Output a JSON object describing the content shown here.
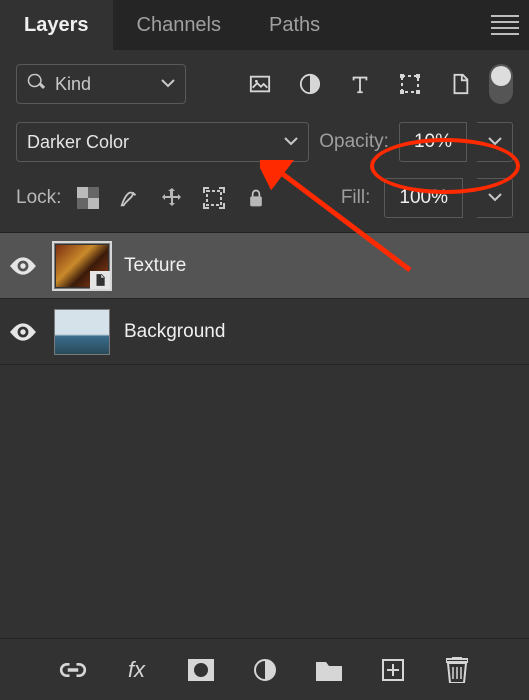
{
  "tabs": {
    "layers": "Layers",
    "channels": "Channels",
    "paths": "Paths"
  },
  "filter": {
    "kind_label": "Kind"
  },
  "blend": {
    "mode": "Darker Color",
    "opacity_label": "Opacity:",
    "opacity_value": "10%"
  },
  "lock": {
    "label": "Lock:",
    "fill_label": "Fill:",
    "fill_value": "100%"
  },
  "layers": [
    {
      "name": "Texture"
    },
    {
      "name": "Background"
    }
  ],
  "bottom": {
    "fx_label": "fx"
  }
}
